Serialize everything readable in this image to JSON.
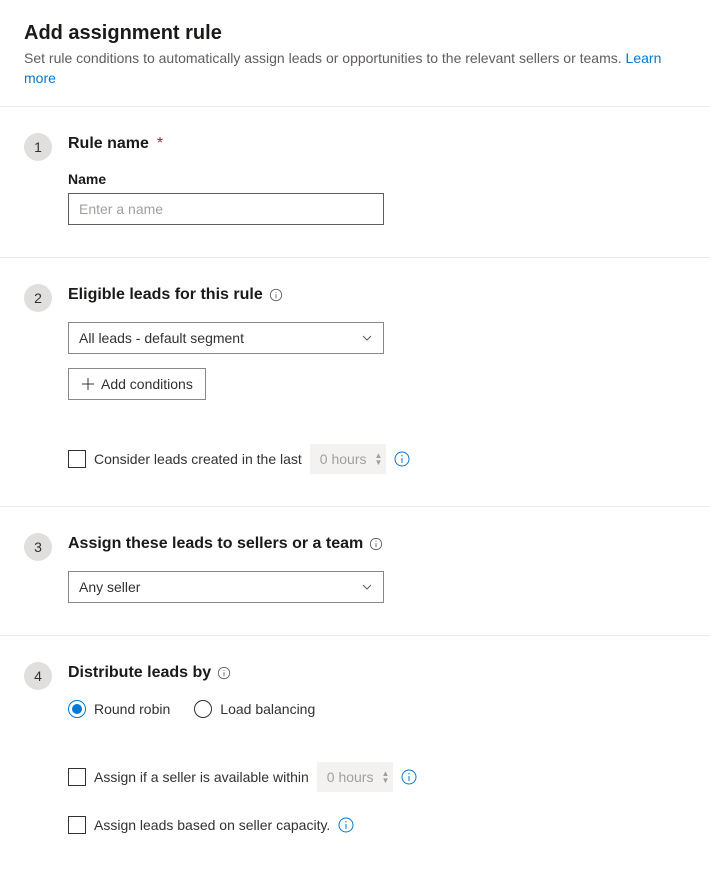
{
  "header": {
    "title": "Add assignment rule",
    "description": "Set rule conditions to automatically assign leads or opportunities to the relevant sellers or teams. ",
    "learn_more": "Learn more"
  },
  "steps": {
    "s1": {
      "badge": "1",
      "title": "Rule name",
      "name_label": "Name",
      "name_placeholder": "Enter a name",
      "name_value": ""
    },
    "s2": {
      "badge": "2",
      "title": "Eligible leads for this rule",
      "segment_selected": "All leads - default segment",
      "add_conditions": "Add conditions",
      "consider_label": "Consider leads created in the last",
      "hours_value": "0 hours"
    },
    "s3": {
      "badge": "3",
      "title": "Assign these leads to sellers or a team",
      "assign_selected": "Any seller"
    },
    "s4": {
      "badge": "4",
      "title": "Distribute leads by",
      "radio_round_robin": "Round robin",
      "radio_load_balancing": "Load balancing",
      "assign_availability_label": "Assign if a seller is available within",
      "availability_value": "0 hours",
      "capacity_label": "Assign leads based on seller capacity."
    }
  }
}
